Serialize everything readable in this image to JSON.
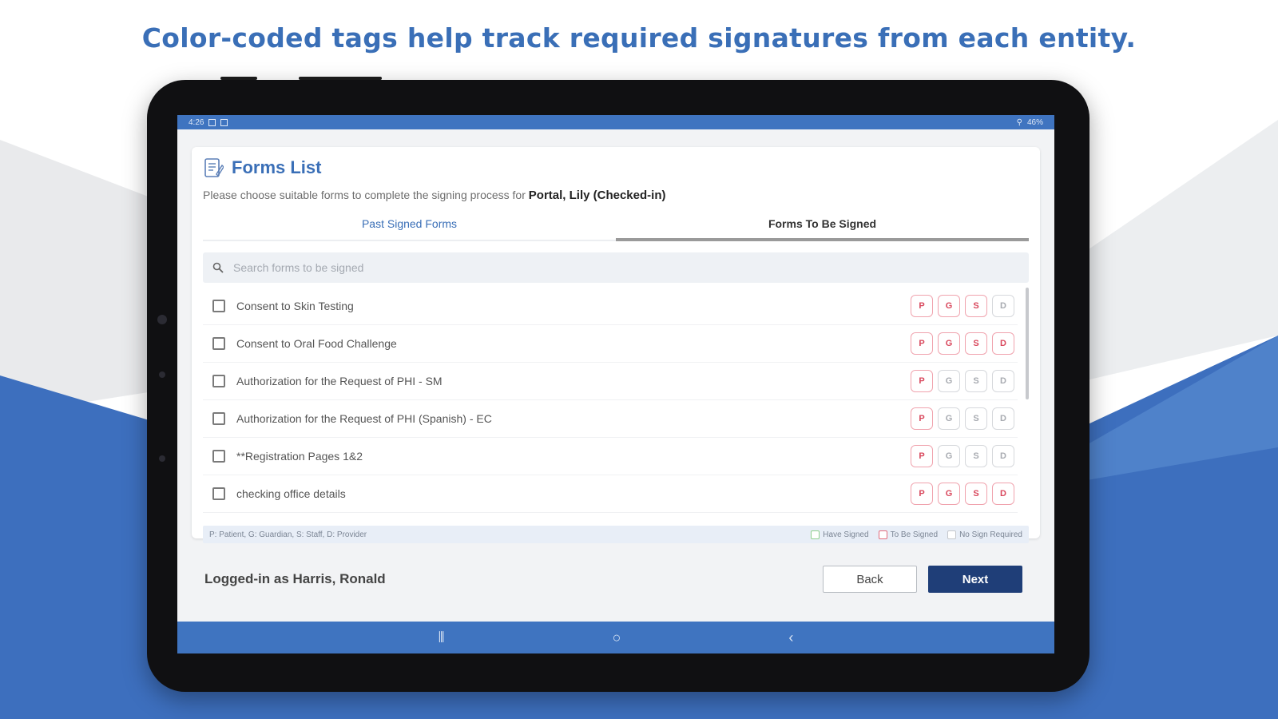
{
  "headline": "Color-coded tags help track required signatures from each entity.",
  "statusbar": {
    "time": "4:26",
    "right_text": "46%"
  },
  "page": {
    "title": "Forms List",
    "subtitle_prefix": "Please choose suitable forms to complete the signing process for",
    "patient": "Portal, Lily (Checked-in)"
  },
  "tabs": [
    {
      "label": "Past Signed Forms",
      "active": false
    },
    {
      "label": "Forms To Be Signed",
      "active": true
    }
  ],
  "search": {
    "placeholder": "Search forms to be signed",
    "value": ""
  },
  "forms": [
    {
      "label": "Consent to Skin Testing",
      "tags": [
        {
          "t": "P",
          "s": "pending"
        },
        {
          "t": "G",
          "s": "pending"
        },
        {
          "t": "S",
          "s": "pending"
        },
        {
          "t": "D",
          "s": "none"
        }
      ]
    },
    {
      "label": "Consent to Oral Food Challenge",
      "tags": [
        {
          "t": "P",
          "s": "pending"
        },
        {
          "t": "G",
          "s": "pending"
        },
        {
          "t": "S",
          "s": "pending"
        },
        {
          "t": "D",
          "s": "pending"
        }
      ]
    },
    {
      "label": "Authorization for the Request of PHI - SM",
      "tags": [
        {
          "t": "P",
          "s": "pending"
        },
        {
          "t": "G",
          "s": "none"
        },
        {
          "t": "S",
          "s": "none"
        },
        {
          "t": "D",
          "s": "none"
        }
      ]
    },
    {
      "label": "Authorization for the Request of PHI (Spanish) - EC",
      "tags": [
        {
          "t": "P",
          "s": "pending"
        },
        {
          "t": "G",
          "s": "none"
        },
        {
          "t": "S",
          "s": "none"
        },
        {
          "t": "D",
          "s": "none"
        }
      ]
    },
    {
      "label": "**Registration Pages 1&2",
      "tags": [
        {
          "t": "P",
          "s": "pending"
        },
        {
          "t": "G",
          "s": "none"
        },
        {
          "t": "S",
          "s": "none"
        },
        {
          "t": "D",
          "s": "none"
        }
      ]
    },
    {
      "label": "checking office details",
      "tags": [
        {
          "t": "P",
          "s": "pending"
        },
        {
          "t": "G",
          "s": "pending"
        },
        {
          "t": "S",
          "s": "pending"
        },
        {
          "t": "D",
          "s": "pending"
        }
      ]
    }
  ],
  "legend": {
    "key_text": "P: Patient, G: Guardian, S: Staff, D: Provider",
    "have_signed": "Have Signed",
    "to_be_signed": "To Be Signed",
    "no_sign": "No Sign Required"
  },
  "footer": {
    "logged_in": "Logged-in as Harris, Ronald",
    "back_label": "Back",
    "next_label": "Next"
  },
  "colors": {
    "accent": "#3a6fb7",
    "nav": "#3f74c0",
    "next_button": "#1f3e78",
    "to_be_signed": "#e26b7c",
    "have_signed": "#8fcf8f"
  },
  "icons": [
    "search-icon",
    "form-doc-icon",
    "recents-icon",
    "home-icon",
    "back-nav-icon"
  ]
}
